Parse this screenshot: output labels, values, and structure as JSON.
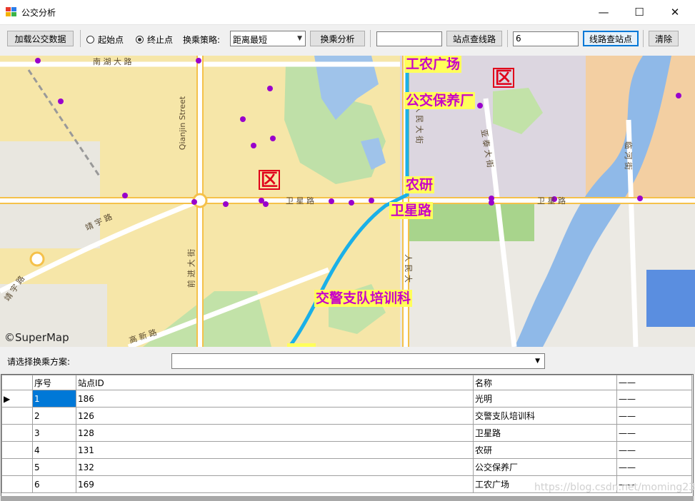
{
  "window": {
    "title": "公交分析",
    "minimize": "—",
    "maximize": "☐",
    "close": "✕"
  },
  "toolbar": {
    "load_button": "加载公交数据",
    "start_radio": "起始点",
    "end_radio": "终止点",
    "strategy_label": "换乘策略:",
    "strategy_value": "距离最短",
    "transfer_button": "换乘分析",
    "station_input": "",
    "station_search_button": "站点查线路",
    "line_input": "6",
    "line_search_button": "线路查站点",
    "clear_button": "清除"
  },
  "map": {
    "copyright": "©SuperMap",
    "district_marks": [
      "区",
      "区"
    ],
    "stop_labels": [
      "工农广场",
      "公交保养厂",
      "农研",
      "卫星路",
      "交警支队培训科"
    ],
    "road_labels": {
      "weixing_1": "卫 星 路",
      "weixing_2": "卫 星 路",
      "qianjin_en": "Qianjin Street",
      "qianjin_zh": "前 进 大 街",
      "jingyu_1": "靖 宇 路",
      "jingyu_2": "靖 宇 路",
      "renmin_1": "人 民 大 街",
      "renmin_2": "人 民 大",
      "yatai": "亚 泰 大 街",
      "linhe": "临 河 街",
      "gaoxin": "高 新 路",
      "nanhu": "南 湖 大 路"
    },
    "colors": {
      "route": "#1ab0e8",
      "stop": "#9900cc",
      "label_bg": "#ffff5a",
      "label_text": "#c800c8"
    }
  },
  "plan": {
    "label": "请选择换乘方案:",
    "selected": ""
  },
  "grid": {
    "columns": [
      "序号",
      "站点ID",
      "名称",
      "——"
    ],
    "rows": [
      [
        "1",
        "186",
        "光明",
        "——"
      ],
      [
        "2",
        "126",
        "交警支队培训科",
        "——"
      ],
      [
        "3",
        "128",
        "卫星路",
        "——"
      ],
      [
        "4",
        "131",
        "农研",
        "——"
      ],
      [
        "5",
        "132",
        "公交保养厂",
        "——"
      ],
      [
        "6",
        "169",
        "工农广场",
        "——"
      ]
    ]
  },
  "watermark": "https://blog.csdn.net/moming23"
}
